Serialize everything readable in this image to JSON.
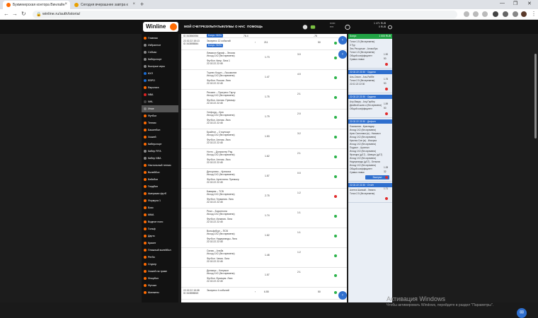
{
  "browser": {
    "tabs": [
      {
        "label": "Букмекерская контора Винлайн",
        "active": true,
        "color": "#ff6a00"
      },
      {
        "label": "Сегодня вчерашнее завтра к",
        "active": false,
        "color": "#e8a000"
      }
    ],
    "url": "winline.ru/auth/istoria/"
  },
  "header": {
    "logo": "Winline",
    "menu": [
      "МОЙ СЧЕТ",
      "РЕЗУЛЬТАТЫ",
      "КЛУБЫ",
      "О НАС",
      "ПОМОЩЬ"
    ],
    "balance_line1": "1 471 RUB",
    "balance_line2": "0 RUB"
  },
  "sidebar": [
    {
      "label": "Главная",
      "color": "#ff6a00"
    },
    {
      "label": "Избранное",
      "color": "#888"
    },
    {
      "label": "Сейчас",
      "color": "#888"
    },
    {
      "label": "Киберспорт",
      "color": "#888"
    },
    {
      "label": "Быстрые игры",
      "color": "#888"
    },
    {
      "label": "КХЛ",
      "color": "#1a6bd0"
    },
    {
      "label": "ЕВРО",
      "color": "#1a6bd0"
    },
    {
      "label": "Евролига",
      "color": "#ff6a00"
    },
    {
      "label": "NBA",
      "color": "#d22"
    },
    {
      "label": "NHL",
      "color": "#444"
    },
    {
      "label": "Иное",
      "color": "#888",
      "selected": true
    },
    {
      "label": "Футбол",
      "color": "#ff6a00"
    },
    {
      "label": "Теннис",
      "color": "#ff6a00"
    },
    {
      "label": "Баскетбол",
      "color": "#ff6a00"
    },
    {
      "label": "Хоккей",
      "color": "#ff6a00"
    },
    {
      "label": "Киберспорт",
      "color": "#ff6a00"
    },
    {
      "label": "Кибер FIFA",
      "color": "#888"
    },
    {
      "label": "Кибер NBA",
      "color": "#888"
    },
    {
      "label": "Настольный теннис",
      "color": "#ff6a00"
    },
    {
      "label": "Волейбол",
      "color": "#ff6a00"
    },
    {
      "label": "Бейсбол",
      "color": "#ff6a00"
    },
    {
      "label": "Гандбол",
      "color": "#ff6a00"
    },
    {
      "label": "Американ футб",
      "color": "#ff6a00"
    },
    {
      "label": "Формула 1",
      "color": "#ff6a00"
    },
    {
      "label": "Бокс",
      "color": "#ff6a00"
    },
    {
      "label": "MMA",
      "color": "#ff6a00"
    },
    {
      "label": "Водное поло",
      "color": "#ff6a00"
    },
    {
      "label": "Гольф",
      "color": "#ff6a00"
    },
    {
      "label": "Дартс",
      "color": "#ff6a00"
    },
    {
      "label": "Крикет",
      "color": "#ff6a00"
    },
    {
      "label": "Пляжный волейбол",
      "color": "#ff6a00"
    },
    {
      "label": "Регби",
      "color": "#ff6a00"
    },
    {
      "label": "Снукер",
      "color": "#ff6a00"
    },
    {
      "label": "Хоккей на траве",
      "color": "#ff6a00"
    },
    {
      "label": "Флорбол",
      "color": "#ff6a00"
    },
    {
      "label": "Футзал",
      "color": "#ff6a00"
    },
    {
      "label": "Шахматы",
      "color": "#ff6a00"
    }
  ],
  "bets": [
    {
      "date": "22.02.22 15:13",
      "id": "ID 343858844",
      "desc": "Экспресс 12 событий",
      "bonus": "Бонус +83%",
      "sum": "211",
      "odds": "",
      "win": "",
      "status": "w"
    },
    {
      "date": "",
      "id": "",
      "desc": "Лимасол Кураф – Эносис",
      "sub": "Футбол. Кипр. Лига 1",
      "time": "22.02.22 22:45",
      "odd": "1.73",
      "score": "3:0",
      "status": "w"
    },
    {
      "date": "",
      "id": "",
      "desc": "Торнео Корун – Локомотив",
      "sub": "Футбол. Россия. Лига",
      "time": "22.02.22 22:45",
      "odd": "1.47",
      "score": "4:0",
      "status": "w"
    },
    {
      "date": "",
      "id": "",
      "desc": "Рессинг – Прогресс Тарту",
      "sub": "Футбол. Англия. Премьер",
      "time": "22.02.22 22:45",
      "odd": "1.75",
      "score": "2:1",
      "status": "w"
    },
    {
      "date": "",
      "id": "",
      "desc": "Уотфорд – Крю",
      "sub": "Футбол. Англия. Лига",
      "time": "22.02.22 22:45",
      "odd": "1.79",
      "score": "2:0",
      "status": "w"
    },
    {
      "date": "",
      "id": "",
      "desc": "Брайтон – Стоунхарт",
      "sub": "Футбол. Англия. Лига",
      "time": "22.02.22 22:45",
      "odd": "1.53",
      "score": "3:2",
      "status": "w"
    },
    {
      "date": "",
      "id": "",
      "desc": "Ноттс – Донкастер Рэд",
      "sub": "Футбол. Англия. Лига",
      "time": "22.02.22 22:45",
      "odd": "1.62",
      "score": "2:1",
      "status": "w"
    },
    {
      "date": "",
      "id": "",
      "desc": "Депортиво – Кремона",
      "sub": "Футбол. Аргентина. Премьер",
      "time": "22.02.22 22:45",
      "odd": "1.57",
      "score": "0:0",
      "status": "w"
    },
    {
      "date": "",
      "id": "",
      "desc": "Бавария – ТСВ",
      "sub": "Футбол. Германия. Лига",
      "time": "22.02.22 22:45",
      "odd": "2.75",
      "score": "1:2",
      "status": "l"
    },
    {
      "date": "",
      "id": "",
      "desc": "Реал – Барселона",
      "sub": "Футбол. Испания. Лига",
      "time": "22.02.22 22:45",
      "odd": "1.74",
      "score": "1:1",
      "status": "w"
    },
    {
      "date": "",
      "id": "",
      "desc": "Вольфсбург – ПСВ",
      "sub": "Футбол. Нидерланды. Лига",
      "time": "22.02.22 22:45",
      "odd": "1.62",
      "score": "1:1",
      "status": "w"
    },
    {
      "date": "",
      "id": "",
      "desc": "Сигма – Альба",
      "sub": "Футбол. Чехия. Лига",
      "time": "22.02.22 22:45",
      "odd": "1.48",
      "score": "1:2",
      "status": "w"
    },
    {
      "date": "",
      "id": "",
      "desc": "Дюнкерк – Клермон",
      "sub": "Футбол. Франция. Лига",
      "time": "22.02.22 22:45",
      "odd": "1.57",
      "score": "2:1",
      "status": "w"
    },
    {
      "date": "22.02.22 15:08",
      "id": "ID 343858815",
      "desc": "Экспресс 4 событий",
      "bonus": "",
      "sum": "50",
      "odds": "6.55",
      "win": "",
      "status": "w"
    }
  ],
  "rpanel": {
    "top_label": "Бонус",
    "top_value": "1 000 RUB",
    "sections": [
      {
        "hdr": "",
        "lines": [
          "Тотал 1.5 (без времени)",
          "3 Тур",
          "Эль Ресоульзе - Атомобра",
          "Тотал 1.5 (без времени)",
          "Общий коэффициент",
          "Сумма ставки"
        ],
        "odd": "1.90",
        "sum": "50"
      },
      {
        "hdr": "22.02.22 22:30 · Ордини",
        "lines": [
          "Аль-Секон - Аль-Раббе",
          "Тотал 2.5 (без времени)",
          "22.02.22 22:30"
        ],
        "odd": "1.75",
        "sum": "50"
      },
      {
        "hdr": "22.02.22 22:30 · Ордини",
        "lines": [
          "Алу-Вицер - Алу-Гарбер",
          "Двойной шанс к (без времени)",
          "Общий коэффициент"
        ],
        "odd": "1.59",
        "sum": "50"
      },
      {
        "hdr": "22.02.22 22:30 · Дефолт",
        "lines": [
          "Локомотив - Краснодар",
          "Исход 1Х2 (без времени)",
          "Арис Салоники (ж) - Ньюкасл",
          "Исход 1Х2 (без времени)",
          "Крылья Сов (ж) - Искорка",
          "Исход 1Х2 (без времени)",
          "Подкаст - Арсенал",
          "Исход 1Х2 (без времени)",
          "Франция (д/17) - Швеция (д/17)",
          "Исход 1Х2 (без времени)",
          "Нидерланды (д/17) - Бельгия",
          "Исход 1Х2 (без времени)",
          "Общий коэффициент",
          "Сумма ставки"
        ],
        "odd": "1.28",
        "sum": "32"
      },
      {
        "hdr": "22.02.22 22:30 · Отчёт",
        "lines": [
          "Алетта Шанхай - Эннита",
          "Тотал 2.5 (без времени)"
        ],
        "odd": "1.71",
        "sum": ""
      }
    ],
    "btn_win": "Выиграл",
    "btn_bonus": "Бонус +83%"
  },
  "activation": {
    "line1": "Активация Windows",
    "line2": "Чтобы активировать Windows, перейдите в раздел \"Параметры\"."
  }
}
